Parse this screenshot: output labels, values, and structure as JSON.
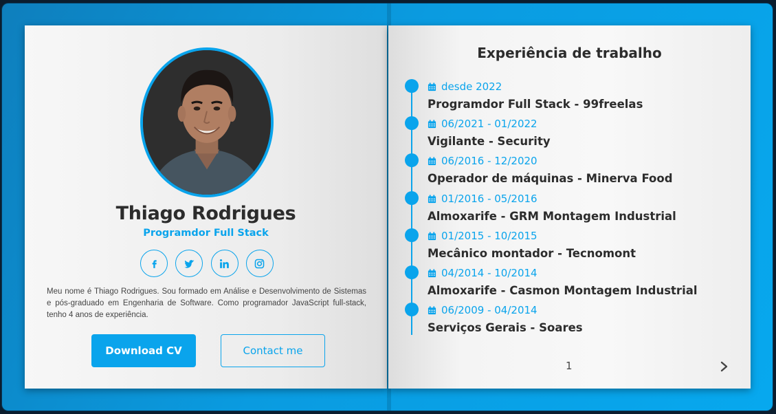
{
  "profile": {
    "name": "Thiago Rodrigues",
    "role": "Programdor Full Stack",
    "bio": "Meu nome é Thiago Rodrigues. Sou formado em Análise e Desenvolvimento de Sistemas e pós-graduado em Engenharia de Software. Como programador JavaScript full-stack, tenho 4 anos de experiência.",
    "socials": [
      {
        "icon": "facebook-icon"
      },
      {
        "icon": "twitter-icon"
      },
      {
        "icon": "linkedin-icon"
      },
      {
        "icon": "instagram-icon"
      }
    ],
    "buttons": {
      "download": "Download CV",
      "contact": "Contact me"
    }
  },
  "experience": {
    "title": "Experiência de trabalho",
    "items": [
      {
        "date": "desde 2022",
        "title": "Programdor Full Stack - 99freelas"
      },
      {
        "date": "06/2021 - 01/2022",
        "title": "Vigilante - Security"
      },
      {
        "date": "06/2016 - 12/2020",
        "title": "Operador de máquinas - Minerva Food"
      },
      {
        "date": "01/2016 - 05/2016",
        "title": "Almoxarife - GRM Montagem Industrial"
      },
      {
        "date": "01/2015 - 10/2015",
        "title": "Mecânico montador - Tecnomont"
      },
      {
        "date": "04/2014 - 10/2014",
        "title": "Almoxarife - Casmon Montagem Industrial"
      },
      {
        "date": "06/2009 - 04/2014",
        "title": "Serviços Gerais - Soares"
      }
    ]
  },
  "pagination": {
    "page": "1"
  },
  "colors": {
    "accent": "#0aa4ec",
    "text": "#2c2c2c"
  }
}
